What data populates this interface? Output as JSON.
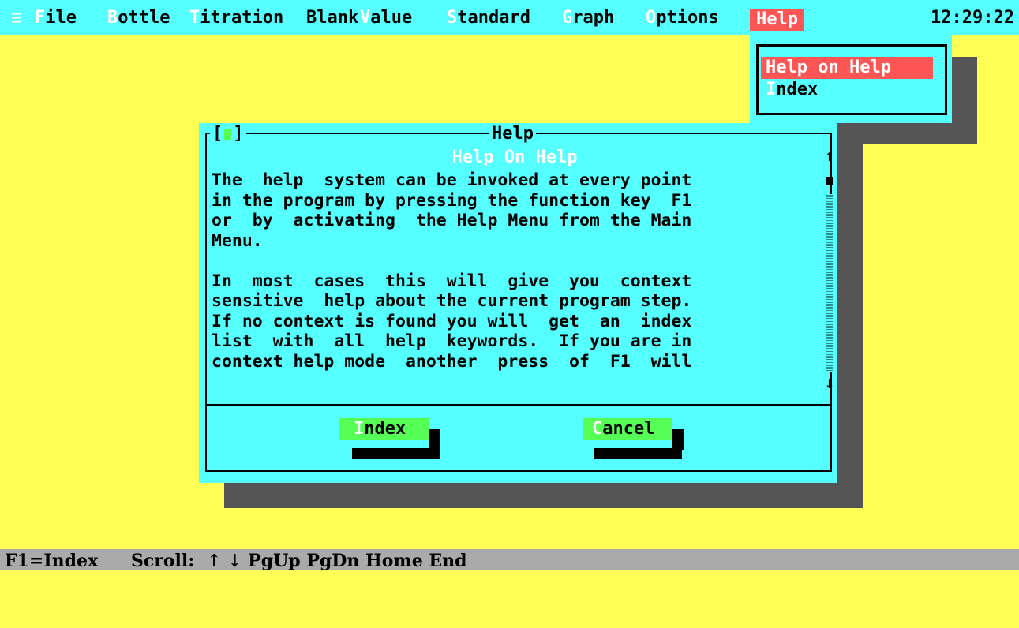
{
  "menubar": {
    "system_glyph": "≡",
    "items": [
      {
        "hot": "F",
        "rest": "ile"
      },
      {
        "hot": "B",
        "rest": "ottle"
      },
      {
        "hot": "T",
        "rest": "itration"
      },
      {
        "hot": "",
        "rest": "Blank"
      },
      {
        "hot": "V",
        "rest": "alue"
      },
      {
        "hot": "S",
        "rest": "tandard"
      },
      {
        "hot": "G",
        "rest": "raph"
      },
      {
        "hot": "O",
        "rest": "ptions"
      },
      {
        "hot": "",
        "rest": "Help"
      }
    ],
    "clock": "12:29:22"
  },
  "help_menu": {
    "items": [
      {
        "hot": "",
        "rest": "Help on Help",
        "selected": true
      },
      {
        "hot": "I",
        "rest": "ndex",
        "selected": false
      }
    ]
  },
  "help_window": {
    "close_left": "[",
    "close_right": "]",
    "title": "Help",
    "heading": "Help On Help",
    "lines": [
      "The  help  system can be invoked at every point",
      "in the program by pressing the function key  F1",
      "or  by  activating  the Help Menu from the Main",
      "Menu.",
      "",
      "In  most  cases  this  will  give  you  context",
      "sensitive  help about the current program step.",
      "If no context is found you will  get  an  index",
      "list  with  all  help  keywords.  If you are in",
      "context help mode  another  press  of  F1  will"
    ],
    "scroll_up": "↑",
    "scroll_down": "↓",
    "buttons": {
      "index": {
        "hot": "I",
        "rest": "ndex"
      },
      "cancel": {
        "hot": "C",
        "rest": "ancel"
      }
    }
  },
  "statusbar": {
    "key_hint": "F1=Index",
    "scroll_label": "Scroll:",
    "scroll_keys": "↑ ↓ PgUp PgDn Home End"
  },
  "colors": {
    "desktop": "#ffff55",
    "menu_bg": "#55ffff",
    "highlight": "#ff5555",
    "button": "#55ff55",
    "shadow": "#555555",
    "status_bg": "#aaaaaa"
  }
}
